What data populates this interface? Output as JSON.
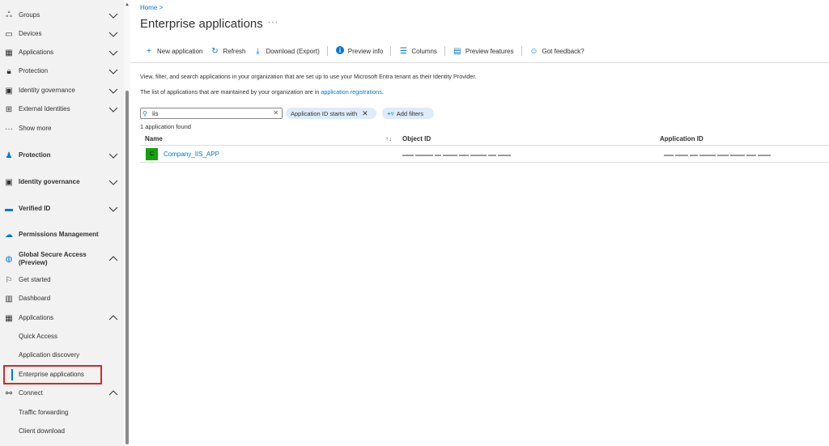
{
  "sidebar": {
    "items": [
      {
        "label": "Groups",
        "icon": "groups-icon",
        "bold": false,
        "chevron": "down"
      },
      {
        "label": "Devices",
        "icon": "devices-icon",
        "bold": false,
        "chevron": "down"
      },
      {
        "label": "Applications",
        "icon": "applications-icon",
        "bold": false,
        "chevron": "down"
      },
      {
        "label": "Protection",
        "icon": "lock-icon",
        "bold": false,
        "chevron": "down"
      },
      {
        "label": "Identity governance",
        "icon": "identity-governance-icon",
        "bold": false,
        "chevron": "down"
      },
      {
        "label": "External Identities",
        "icon": "external-identities-icon",
        "bold": false,
        "chevron": "down"
      },
      {
        "label": "Show more",
        "icon": "ellipsis-icon",
        "bold": false,
        "chevron": ""
      },
      {
        "label": "Protection",
        "icon": "protection-icon",
        "bold": true,
        "chevron": "down"
      },
      {
        "label": "Identity governance",
        "icon": "identity-governance-icon",
        "bold": true,
        "chevron": "down"
      },
      {
        "label": "Verified ID",
        "icon": "verified-id-icon",
        "bold": true,
        "chevron": "down"
      },
      {
        "label": "Permissions Management",
        "icon": "cloud-icon",
        "bold": true,
        "chevron": ""
      },
      {
        "label": "Global Secure Access",
        "label2": "(Preview)",
        "icon": "globe-icon",
        "bold": true,
        "chevron": "up"
      },
      {
        "label": "Get started",
        "icon": "flag-icon",
        "bold": false,
        "chevron": ""
      },
      {
        "label": "Dashboard",
        "icon": "dashboard-icon",
        "bold": false,
        "chevron": ""
      },
      {
        "label": "Applications",
        "icon": "applications-icon",
        "bold": false,
        "chevron": "up"
      },
      {
        "label": "Quick Access",
        "icon": "",
        "bold": false,
        "chevron": ""
      },
      {
        "label": "Application discovery",
        "icon": "",
        "bold": false,
        "chevron": ""
      },
      {
        "label": "Enterprise applications",
        "icon": "",
        "bold": false,
        "chevron": "",
        "selected": true
      },
      {
        "label": "Connect",
        "icon": "connect-icon",
        "bold": false,
        "chevron": "up"
      },
      {
        "label": "Traffic forwarding",
        "icon": "",
        "bold": false,
        "chevron": ""
      },
      {
        "label": "Client download",
        "icon": "",
        "bold": false,
        "chevron": ""
      }
    ]
  },
  "header": {
    "breadcrumb": "Home  >",
    "title": "Enterprise applications",
    "more": "···"
  },
  "toolbar": {
    "new_application": "New application",
    "refresh": "Refresh",
    "download": "Download (Export)",
    "preview_info": "Preview info",
    "columns": "Columns",
    "preview_features": "Preview features",
    "feedback": "Got feedback?"
  },
  "description": {
    "line1": "View, filter, and search applications in your organization that are set up to use your Microsoft Entra tenant as their Identity Provider.",
    "line2_prefix": "The list of applications that are maintained by your organization are in ",
    "line2_link": "application registrations",
    "line2_suffix": "."
  },
  "search": {
    "value": "iis",
    "placeholder": ""
  },
  "filters": {
    "active_filter": "Application ID starts with",
    "add_filters": "Add filters"
  },
  "results": {
    "count_text": "1 application found",
    "columns": [
      "Name",
      "Object ID",
      "Application ID"
    ],
    "rows": [
      {
        "avatar_letter": "C",
        "name": "Company_IIS_APP"
      }
    ]
  },
  "colors": {
    "accent": "#0078d4",
    "avatar": "#13a10e",
    "highlight": "#d9262c"
  }
}
